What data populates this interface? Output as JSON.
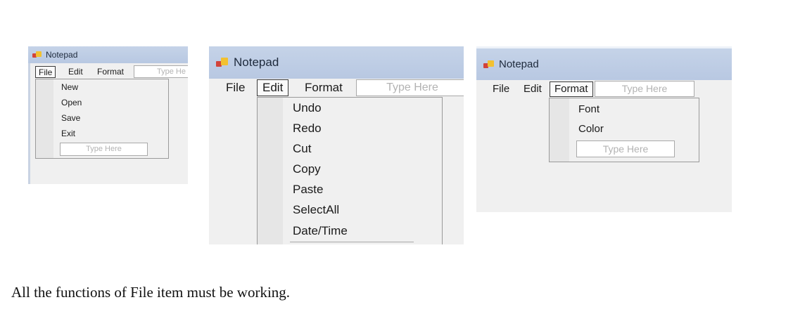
{
  "windows": [
    {
      "title": "Notepad",
      "menu": [
        "File",
        "Edit",
        "Format"
      ],
      "menu_placeholder": "Type He",
      "active_menu": "File",
      "dropdown_items": [
        "New",
        "Open",
        "Save",
        "Exit"
      ],
      "dropdown_placeholder": "Type Here"
    },
    {
      "title": "Notepad",
      "menu": [
        "File",
        "Edit",
        "Format"
      ],
      "menu_placeholder": "Type Here",
      "active_menu": "Edit",
      "dropdown_items": [
        "Undo",
        "Redo",
        "Cut",
        "Copy",
        "Paste",
        "SelectAll",
        "Date/Time"
      ]
    },
    {
      "title": "Notepad",
      "menu": [
        "File",
        "Edit",
        "Format"
      ],
      "menu_placeholder": "Type Here",
      "active_menu": "Format",
      "dropdown_items": [
        "Font",
        "Color"
      ],
      "dropdown_placeholder": "Type Here"
    }
  ],
  "caption": "All the functions of File item must be working."
}
